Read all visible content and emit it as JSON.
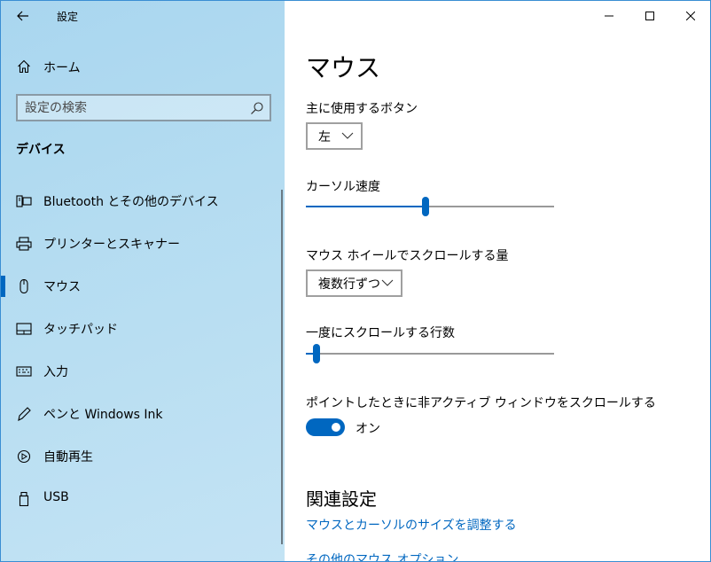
{
  "window": {
    "title": "設定",
    "controls": {
      "minimize": "–",
      "maximize": "☐",
      "close": "✕"
    }
  },
  "sidebar": {
    "home_label": "ホーム",
    "search_placeholder": "設定の検索",
    "section_title": "デバイス",
    "items": [
      {
        "label": "Bluetooth とその他のデバイス",
        "icon": "bluetooth-devices-icon"
      },
      {
        "label": "プリンターとスキャナー",
        "icon": "printer-icon"
      },
      {
        "label": "マウス",
        "icon": "mouse-icon",
        "selected": true
      },
      {
        "label": "タッチパッド",
        "icon": "touchpad-icon"
      },
      {
        "label": "入力",
        "icon": "keyboard-icon"
      },
      {
        "label": "ペンと Windows Ink",
        "icon": "pen-icon"
      },
      {
        "label": "自動再生",
        "icon": "autoplay-icon"
      },
      {
        "label": "USB",
        "icon": "usb-icon"
      }
    ]
  },
  "main": {
    "title": "マウス",
    "primary_button": {
      "label": "主に使用するボタン",
      "value": "左"
    },
    "cursor_speed": {
      "label": "カーソル速度",
      "level": 0.48
    },
    "wheel_scroll": {
      "label": "マウス ホイールでスクロールする量",
      "value": "複数行ずつ"
    },
    "lines_to_scroll": {
      "label": "一度にスクロールする行数",
      "level": 0.03
    },
    "inactive_scroll": {
      "label": "ポイントしたときに非アクティブ ウィンドウをスクロールする",
      "state": "オン",
      "on": true
    },
    "related": {
      "title": "関連設定",
      "links": [
        "マウスとカーソルのサイズを調整する",
        "その他のマウス オプション"
      ]
    }
  },
  "colors": {
    "accent": "#0067c0",
    "sidebar_bg": "#b4dcf1"
  }
}
